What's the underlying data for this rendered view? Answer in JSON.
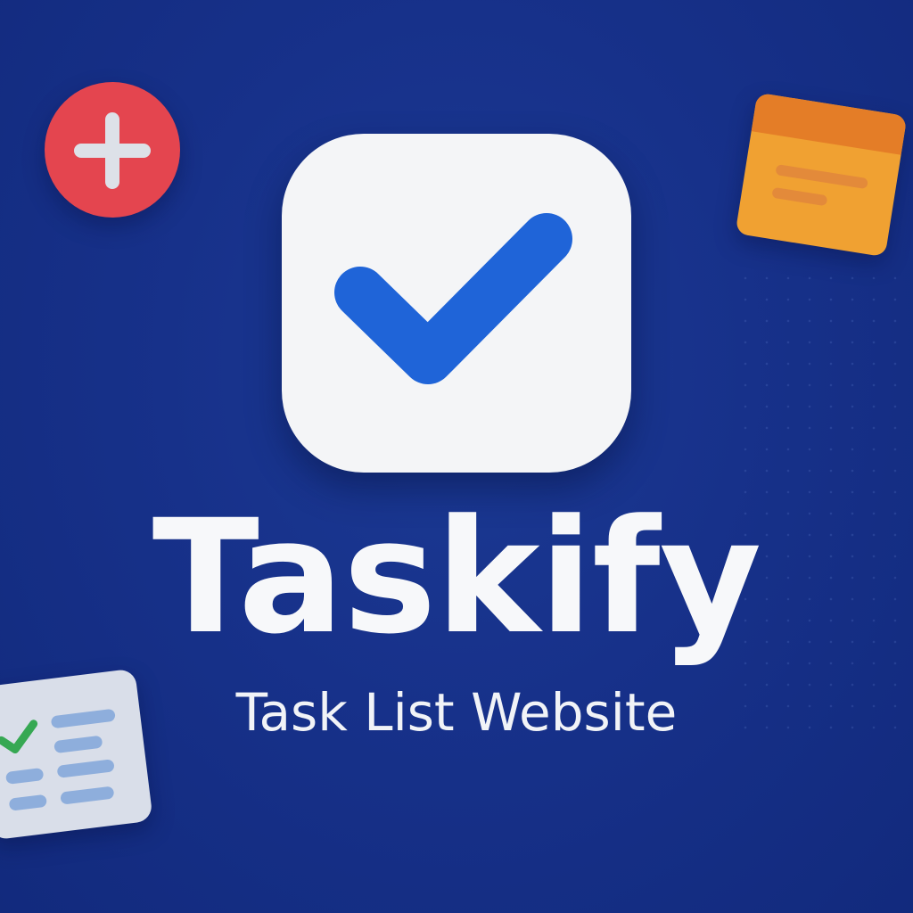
{
  "branding": {
    "app_name": "Taskify",
    "tagline": "Task List Website"
  },
  "icons": {
    "main": "checkmark-icon",
    "top_left": "plus-icon",
    "top_right": "sticky-note-icon",
    "bottom_left": "checklist-icon"
  },
  "colors": {
    "background": "#17318a",
    "icon_tile": "#f4f5f7",
    "check_blue": "#1f64d8",
    "plus_red": "#e4454f",
    "note_orange": "#f0a132",
    "checklist_gray": "#d9dee9",
    "check_green": "#36a853",
    "text": "#f7f8fa"
  }
}
